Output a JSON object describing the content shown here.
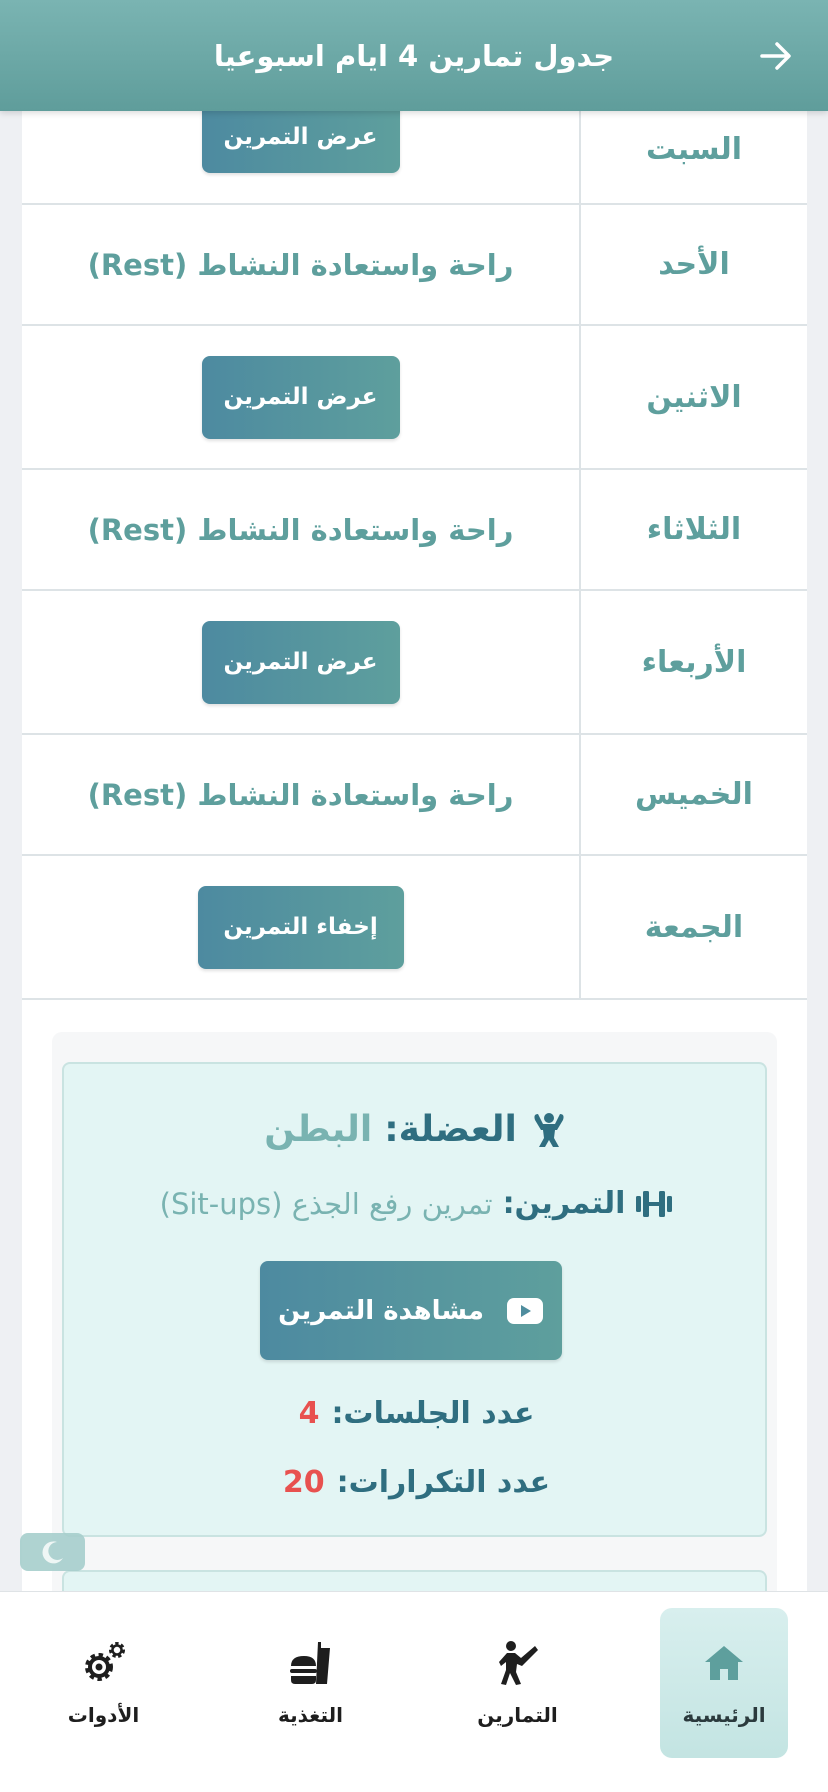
{
  "header": {
    "title": "جدول تمارين 4 ايام اسبوعيا",
    "back_icon": "arrow-right-icon"
  },
  "schedule": [
    {
      "day": "السبت",
      "type": "button",
      "label": "عرض التمرين"
    },
    {
      "day": "الأحد",
      "type": "text",
      "label": "راحة واستعادة النشاط (Rest)"
    },
    {
      "day": "الاثنين",
      "type": "button",
      "label": "عرض التمرين"
    },
    {
      "day": "الثلاثاء",
      "type": "text",
      "label": "راحة واستعادة النشاط (Rest)"
    },
    {
      "day": "الأربعاء",
      "type": "button",
      "label": "عرض التمرين"
    },
    {
      "day": "الخميس",
      "type": "text",
      "label": "راحة واستعادة النشاط (Rest)"
    },
    {
      "day": "الجمعة",
      "type": "button",
      "label": "إخفاء التمرين"
    }
  ],
  "detail": {
    "muscle_label": "العضلة:",
    "muscle_value": "البطن",
    "exercise_label": "التمرين:",
    "exercise_value": "تمرين رفع الجذع (Sit-ups)",
    "watch_button": "مشاهدة التمرين",
    "sets_label": "عدد الجلسات:",
    "sets_value": "4",
    "reps_label": "عدد التكرارات:",
    "reps_value": "20"
  },
  "nav": {
    "home": "الرئيسية",
    "workouts": "التمارين",
    "nutrition": "التغذية",
    "tools": "الأدوات"
  },
  "colors": {
    "accent": "#5e9f9d",
    "dark_accent": "#2f6e80",
    "value_red": "#e8514f"
  }
}
